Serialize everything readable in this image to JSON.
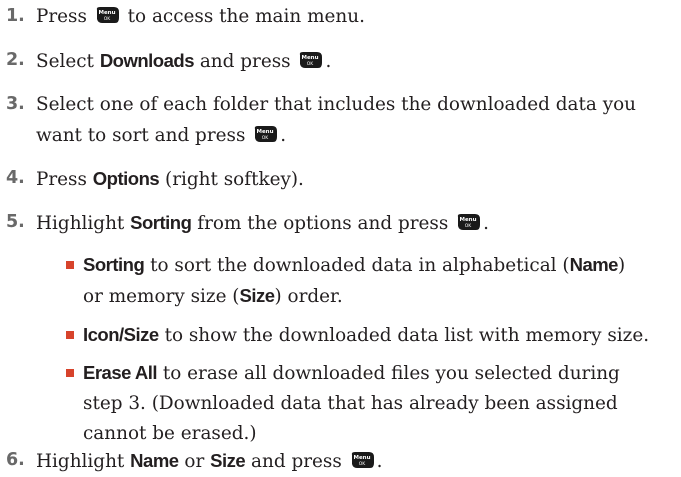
{
  "icons": {
    "menu_key": "menu-ok-key-icon",
    "bullet": "bullet-square-icon",
    "accent": "#d7432b"
  },
  "steps": [
    {
      "num": "1.",
      "t1": "Press",
      "t2": "to access the main menu."
    },
    {
      "num": "2.",
      "t1": "Select",
      "k1": "Downloads",
      "t2": "and press",
      "t3": "."
    },
    {
      "num": "3.",
      "l1": "Select one of each folder that includes the downloaded data you",
      "l2a": "want to sort and press",
      "l2b": "."
    },
    {
      "num": "4.",
      "t1": "Press",
      "k1": "Options",
      "t2": "(right softkey)."
    },
    {
      "num": "5.",
      "t1": "Highlight",
      "k1": "Sorting",
      "t2": "from the options and press",
      "t3": "."
    },
    {
      "num": "6.",
      "t1": "Highlight",
      "k1": "Name",
      "t2": "or",
      "k2": "Size",
      "t3": "and press",
      "t4": "."
    }
  ],
  "options": [
    {
      "k": "Sorting",
      "t1": "to sort the downloaded data in alphabetical (",
      "k2": "Name",
      "t2": ")",
      "l2a": "or memory size (",
      "l2k": "Size",
      "l2b": ") order."
    },
    {
      "k": "Icon/Size",
      "t1": "to show the downloaded data list with memory size."
    },
    {
      "k": "Erase All",
      "t1": "to erase all downloaded files you selected during",
      "l2": "step 3. (Downloaded data that has already been assigned",
      "l3": "cannot be erased.)"
    }
  ]
}
